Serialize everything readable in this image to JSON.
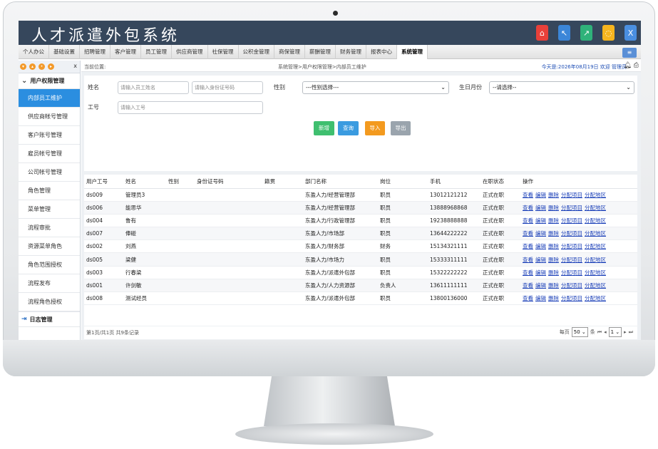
{
  "app": {
    "title": "人才派遣外包系统"
  },
  "header_buttons": [
    {
      "icon": "home-icon",
      "color": "#e8403a",
      "glyph": "⌂"
    },
    {
      "icon": "back-icon",
      "color": "#3b86d8",
      "glyph": "↖"
    },
    {
      "icon": "forward-icon",
      "color": "#2fb27a",
      "glyph": "↗"
    },
    {
      "icon": "lightbulb-icon",
      "color": "#f6b51e",
      "glyph": "◌"
    },
    {
      "icon": "close-icon",
      "color": "#4a8fe0",
      "glyph": "X"
    }
  ],
  "nav": {
    "items": [
      "个人办公",
      "基础设置",
      "招聘管理",
      "客户管理",
      "员工管理",
      "供应商管理",
      "社保管理",
      "公积金管理",
      "商保管理",
      "薪酬管理",
      "财务管理",
      "报表中心",
      "系统管理"
    ],
    "active": "系统管理"
  },
  "sidebar": {
    "group_label": "用户权限管理",
    "items": [
      "内部员工维护",
      "供应商帐号管理",
      "客户账号管理",
      "雇员帐号管理",
      "公司帐号管理",
      "角色管理",
      "菜单管理",
      "流程审批",
      "资源菜单角色",
      "角色范围授权",
      "流程发布",
      "流程角色授权"
    ],
    "active_index": 0,
    "bottom_group": "日志管理",
    "close": "x"
  },
  "breadcrumb": {
    "label": "当前位置:",
    "path": "系统管理>用户权限管理>内部员工维护",
    "greeting": "今天是:2026年08月19日 欢迎 管理员"
  },
  "search": {
    "name_label": "姓名",
    "name_placeholder": "请输入员工姓名",
    "id_placeholder": "请输入身份证号码",
    "gender_label": "性别",
    "gender_value": "---性别选择---",
    "birth_label": "生日月份",
    "birth_value": "--请选择--",
    "empno_label": "工号",
    "empno_placeholder": "请输入工号"
  },
  "buttons": {
    "add": "新增",
    "query": "查询",
    "import": "导入",
    "export": "导出"
  },
  "table": {
    "headers": [
      "用户工号",
      "姓名",
      "性别",
      "身份证号码",
      "籍贯",
      "部门名称",
      "岗位",
      "手机",
      "在职状态",
      "操作"
    ],
    "actions": [
      "查看",
      "编辑",
      "删除",
      "分配项目",
      "分配地区"
    ],
    "rows": [
      [
        "ds009",
        "管理员3",
        "",
        "",
        "",
        "东盈人力/经营管理部",
        "职员",
        "13012121212",
        "正式在职"
      ],
      [
        "ds006",
        "能思华",
        "",
        "",
        "",
        "东盈人力/经营管理部",
        "职员",
        "13888968868",
        "正式在职"
      ],
      [
        "ds004",
        "鲁有",
        "",
        "",
        "",
        "东盈人力/行政管理部",
        "职员",
        "19238888888",
        "正式在职"
      ],
      [
        "ds007",
        "俸碰",
        "",
        "",
        "",
        "东盈人力/市场部",
        "职员",
        "13644222222",
        "正式在职"
      ],
      [
        "ds002",
        "刘燕",
        "",
        "",
        "",
        "东盈人力/财务部",
        "财务",
        "15134321111",
        "正式在职"
      ],
      [
        "ds005",
        "梁健",
        "",
        "",
        "",
        "东盈人力/市场力",
        "职员",
        "15333311111",
        "正式在职"
      ],
      [
        "ds003",
        "行春梁",
        "",
        "",
        "",
        "东盈人力/派遣外包部",
        "职员",
        "15322222222",
        "正式在职"
      ],
      [
        "ds001",
        "许剑敏",
        "",
        "",
        "",
        "东盈人力/人力资源部",
        "负责人",
        "13611111111",
        "正式在职"
      ],
      [
        "ds008",
        "测试经员",
        "",
        "",
        "",
        "东盈人力/派遣外包部",
        "职员",
        "13800136000",
        "正式在职"
      ]
    ]
  },
  "pager": {
    "summary": "第1页/共1页 共9条记录",
    "per_page_label": "每页",
    "per_page_value": "50",
    "unit": "条",
    "page_value": "1"
  }
}
